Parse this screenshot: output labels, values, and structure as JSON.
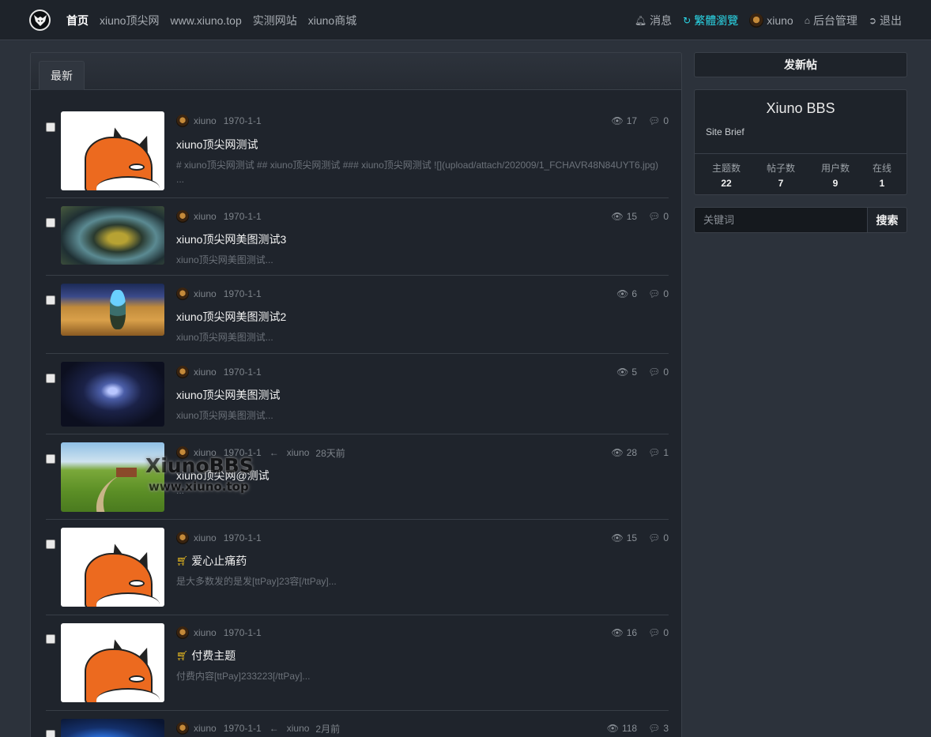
{
  "nav": {
    "left": [
      {
        "label": "首页",
        "active": true
      },
      {
        "label": "xiuno顶尖网",
        "active": false
      },
      {
        "label": "www.xiuno.top",
        "active": false
      },
      {
        "label": "实测网站",
        "active": false
      },
      {
        "label": "xiuno商城",
        "active": false
      }
    ],
    "right": {
      "messages": "消息",
      "traditional": "繁體瀏覽",
      "user": "xiuno",
      "admin": "后台管理",
      "logout": "退出"
    }
  },
  "tabs": {
    "latest": "最新"
  },
  "threads": [
    {
      "user": "xiuno",
      "date": "1970-1-1",
      "views": "17",
      "replies": "0",
      "title": "xiuno顶尖网测试",
      "brief": "# xiuno顶尖网测试 ## xiuno顶尖网测试 ### xiuno顶尖网测试 ![](upload/attach/202009/1_FCHAVR48N84UYT6.jpg) ...",
      "thumb": "fox-icon"
    },
    {
      "user": "xiuno",
      "date": "1970-1-1",
      "views": "15",
      "replies": "0",
      "title": "xiuno顶尖网美图测试3",
      "brief": "xiuno顶尖网美图测试...",
      "thumb": "swirl"
    },
    {
      "user": "xiuno",
      "date": "1970-1-1",
      "views": "6",
      "replies": "0",
      "title": "xiuno顶尖网美图测试2",
      "brief": "xiuno顶尖网美图测试...",
      "thumb": "desert"
    },
    {
      "user": "xiuno",
      "date": "1970-1-1",
      "views": "5",
      "replies": "0",
      "title": "xiuno顶尖网美图测试",
      "brief": "xiuno顶尖网美图测试...",
      "thumb": "galaxy"
    },
    {
      "user": "xiuno",
      "date": "1970-1-1",
      "last_user": "xiuno",
      "last_time": "28天前",
      "views": "28",
      "replies": "1",
      "title": "xiuno顶尖网@测试",
      "brief": "...",
      "thumb": "meadow"
    },
    {
      "user": "xiuno",
      "date": "1970-1-1",
      "views": "15",
      "replies": "0",
      "title": "爱心止痛药",
      "brief": "是大多数发的是发[ttPay]23容[/ttPay]...",
      "thumb": "fox-icon",
      "cart": true
    },
    {
      "user": "xiuno",
      "date": "1970-1-1",
      "views": "16",
      "replies": "0",
      "title": "付费主题",
      "brief": "付费内容[ttPay]233223[/ttPay]...",
      "thumb": "fox-icon",
      "cart": true
    },
    {
      "user": "xiuno",
      "date": "1970-1-1",
      "last_user": "xiuno",
      "last_time": "2月前",
      "views": "118",
      "replies": "3",
      "thumb": "blue"
    }
  ],
  "watermark": {
    "line1": "XiunoBBS",
    "line2": "www.xiuno.top"
  },
  "sidebar": {
    "new_post": "发新帖",
    "site_name": "Xiuno BBS",
    "site_brief": "Site Brief",
    "stats": [
      {
        "label": "主题数",
        "value": "22"
      },
      {
        "label": "帖子数",
        "value": "7"
      },
      {
        "label": "用户数",
        "value": "9"
      },
      {
        "label": "在线",
        "value": "1"
      }
    ],
    "search_placeholder": "关键词",
    "search_button": "搜索"
  },
  "colors": {
    "accent": "#2bd8e8",
    "cart": "#f0c020",
    "bg": "#2c323b",
    "card": "#1f242c"
  }
}
